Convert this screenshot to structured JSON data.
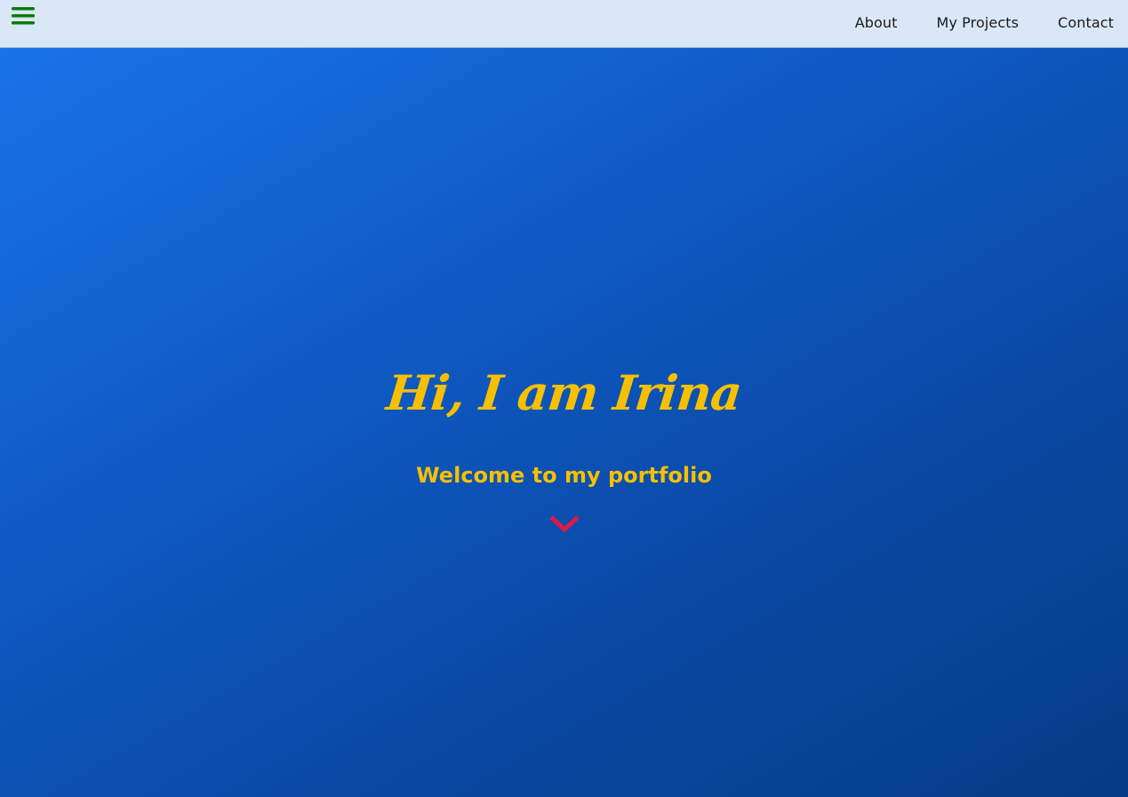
{
  "header": {
    "menu_icon": "hamburger-menu-icon",
    "menu_icon_color": "#0b7a0b",
    "nav": [
      {
        "label": "About"
      },
      {
        "label": "My Projects"
      },
      {
        "label": "Contact"
      }
    ]
  },
  "hero": {
    "title": "Hi, I am Irina",
    "subtitle": "Welcome to my portfolio",
    "scroll_icon": "chevron-down-icon",
    "accent_color": "#f6c000",
    "chevron_color": "#e0194a"
  }
}
